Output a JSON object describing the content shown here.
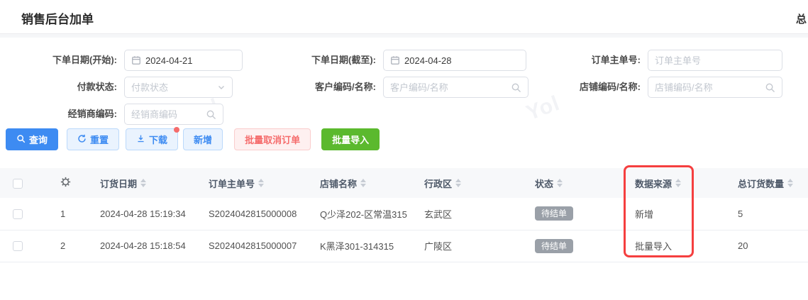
{
  "page": {
    "title": "销售后台加单",
    "corner_text": "总",
    "watermark_text": "Yol"
  },
  "colors": {
    "primary_blue": "#3D8BF2",
    "light_blue_bg": "#EAF3FE",
    "light_blue_border": "#BBD9FB",
    "danger_red": "#F56C6C",
    "danger_bg": "#FEF0F0",
    "success_green": "#5BB92E",
    "badge_gray": "#9AA0A8",
    "annotation_red": "#F53F3F"
  },
  "filters": {
    "date_start": {
      "label": "下单日期(开始):",
      "value": "2024-04-21"
    },
    "date_end": {
      "label": "下单日期(截至):",
      "value": "2024-04-28"
    },
    "order_no": {
      "label": "订单主单号:",
      "placeholder": "订单主单号"
    },
    "pay_status": {
      "label": "付款状态:",
      "placeholder": "付款状态"
    },
    "customer": {
      "label": "客户编码/名称:",
      "placeholder": "客户编码/名称"
    },
    "shop": {
      "label": "店铺编码/名称:",
      "placeholder": "店铺编码/名称"
    },
    "dealer": {
      "label": "经销商编码:",
      "placeholder": "经销商编码"
    }
  },
  "toolbar": {
    "query": "查询",
    "reset": "重置",
    "download": "下载",
    "add": "新增",
    "batch_cancel": "批量取消订单",
    "batch_import": "批量导入"
  },
  "table": {
    "headers": {
      "order_date": "订货日期",
      "order_no": "订单主单号",
      "store": "店铺名称",
      "district": "行政区",
      "status": "状态",
      "source": "数据来源",
      "qty": "总订货数量"
    },
    "rows": [
      {
        "index": "1",
        "order_date": "2024-04-28 15:19:34",
        "order_no": "S2024042815000008",
        "store": "Q少泽202-区常温315",
        "district": "玄武区",
        "status": "待结单",
        "source": "新增",
        "qty": "5"
      },
      {
        "index": "2",
        "order_date": "2024-04-28 15:18:54",
        "order_no": "S2024042815000007",
        "store": "K黑泽301-314315",
        "district": "广陵区",
        "status": "待结单",
        "source": "批量导入",
        "qty": "20"
      }
    ]
  }
}
